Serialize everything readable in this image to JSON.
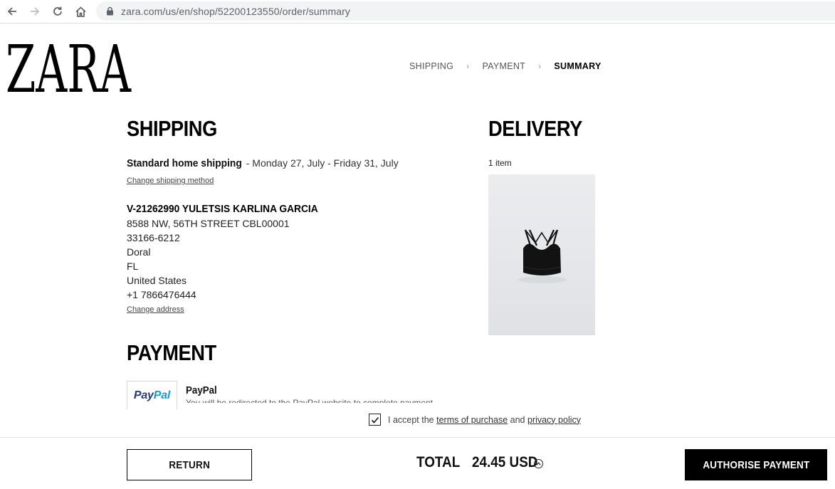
{
  "browser": {
    "url": "zara.com/us/en/shop/52200123550/order/summary",
    "icons": [
      "back-arrow-icon",
      "forward-arrow-icon",
      "reload-icon",
      "home-icon",
      "lock-icon"
    ]
  },
  "brand": {
    "logo_text": "ZARA"
  },
  "steps": [
    {
      "label": "SHIPPING",
      "active": false
    },
    {
      "label": "PAYMENT",
      "active": false
    },
    {
      "label": "SUMMARY",
      "active": true
    }
  ],
  "step_separator": "›",
  "shipping": {
    "heading": "SHIPPING",
    "method": "Standard home shipping",
    "dates": " - Monday 27, July - Friday 31, July",
    "change_method_link": "Change shipping method",
    "address": {
      "name": "V-21262990 YULETSIS KARLINA GARCIA",
      "street": "8588 NW, 56TH STREET CBL00001",
      "zip": "33166-6212",
      "city": "Doral",
      "state": "FL",
      "country": "United States",
      "phone": "+1 7866476444"
    },
    "change_address_link": "Change address"
  },
  "payment": {
    "heading": "PAYMENT",
    "logo_pay": "Pay",
    "logo_pal": "Pal",
    "method_title": "PayPal",
    "method_desc": "You will be redirected to the PayPal website to complete payment"
  },
  "delivery": {
    "heading": "DELIVERY",
    "item_count": "1 item",
    "product_icon": "black-bralette-image"
  },
  "terms": {
    "checked": true,
    "prefix": "I accept the ",
    "terms_link": "terms of purchase",
    "middle": " and ",
    "privacy_link": "privacy policy"
  },
  "footer": {
    "return_label": "RETURN",
    "total_label": "TOTAL",
    "total_value": "24.45 USD",
    "authorise_label": "AUTHORISE PAYMENT"
  },
  "colors": {
    "accent": "#000000",
    "paypal_dark": "#253b80",
    "paypal_light": "#179bd7"
  }
}
